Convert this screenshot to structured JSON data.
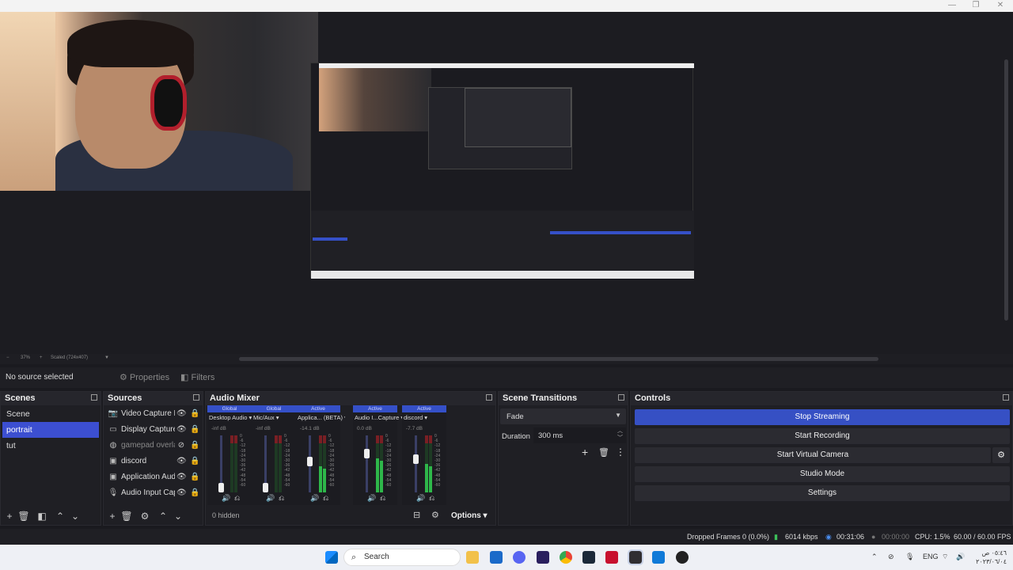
{
  "window": {
    "minimize": "—",
    "restore": "❐",
    "close": "✕"
  },
  "zoom": {
    "minus": "−",
    "percent": "37%",
    "plus": "+",
    "scale_label": "Scaled (724x407)"
  },
  "props": {
    "no_source": "No source selected",
    "properties": "Properties",
    "filters": "Filters"
  },
  "scenes": {
    "title": "Scenes",
    "items": [
      {
        "label": "Scene"
      },
      {
        "label": "portrait"
      },
      {
        "label": "tut"
      }
    ],
    "selected_index": 1
  },
  "sources": {
    "title": "Sources",
    "items": [
      {
        "label": "Video Capture D",
        "icon": "camera-icon"
      },
      {
        "label": "Display Capture",
        "icon": "monitor-icon"
      },
      {
        "label": "gamepad overla",
        "icon": "browser-icon"
      },
      {
        "label": "discord",
        "icon": "window-icon"
      },
      {
        "label": "Application Audi",
        "icon": "window-icon"
      },
      {
        "label": "Audio Input Cap",
        "icon": "mic-icon"
      }
    ]
  },
  "mixer": {
    "title": "Audio Mixer",
    "channels": [
      {
        "tag": "Global",
        "name": "Desktop Audio",
        "db": "-inf dB",
        "level": 0.0
      },
      {
        "tag": "Global",
        "name": "Mic/Aux",
        "db": "-inf dB",
        "level": 0.0
      },
      {
        "tag": "Active",
        "name": "Applica... (BETA)",
        "db": "-14.1 dB",
        "level": 0.55
      },
      {
        "tag": "Active",
        "name": "Audio I...Capture",
        "db": "0.0 dB",
        "level": 0.72
      },
      {
        "tag": "Active",
        "name": "discord",
        "db": "-7.7 dB",
        "level": 0.6
      }
    ],
    "scale": [
      "0",
      "-6",
      "-12",
      "-18",
      "-24",
      "-30",
      "-36",
      "-42",
      "-48",
      "-54",
      "-60"
    ],
    "hidden": "0 hidden",
    "options": "Options"
  },
  "transitions": {
    "title": "Scene Transitions",
    "type": "Fade",
    "duration_label": "Duration",
    "duration_value": "300 ms"
  },
  "controls": {
    "title": "Controls",
    "buttons": [
      "Stop Streaming",
      "Start Recording",
      "Start Virtual Camera",
      "Studio Mode",
      "Settings"
    ]
  },
  "status": {
    "dropped": "Dropped Frames 0 (0.0%)",
    "kbps": "6014 kbps",
    "live_time": "00:31:06",
    "rec_time": "00:00:00",
    "cpu": "CPU: 1.5%",
    "fps": "60.00 / 60.00 FPS"
  },
  "taskbar": {
    "search": "Search",
    "lang": "ENG",
    "time": "٠٥:٤٦ ص",
    "date": "٢٠٢٣/٠٦/٠٤"
  },
  "colors": {
    "accent": "#3c4fd1",
    "meter_green": "#2eb84a",
    "meter_red": "#7a1f24"
  }
}
